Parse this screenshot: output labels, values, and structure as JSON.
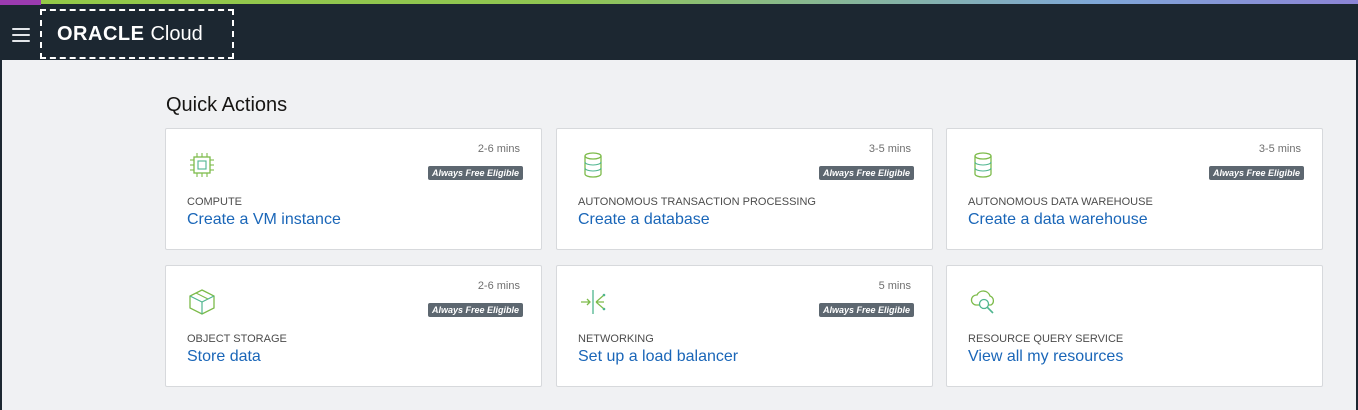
{
  "header": {
    "brand_oracle": "ORACLE",
    "brand_cloud": "Cloud",
    "menu_icon": "hamburger-menu-icon"
  },
  "colors": {
    "topbar": "#1c2731",
    "link": "#1a66b8",
    "badge": "#5d6770",
    "icon_green": "#7dbb4a",
    "icon_teal": "#4fb58f"
  },
  "quick_actions": {
    "title": "Quick Actions",
    "cards": [
      {
        "icon": "compute-chip-icon",
        "time": "2-6 mins",
        "badge": "Always Free Eligible",
        "category": "COMPUTE",
        "action": "Create a VM instance"
      },
      {
        "icon": "database-icon",
        "time": "3-5 mins",
        "badge": "Always Free Eligible",
        "category": "AUTONOMOUS TRANSACTION PROCESSING",
        "action": "Create a database"
      },
      {
        "icon": "database-icon",
        "time": "3-5 mins",
        "badge": "Always Free Eligible",
        "category": "AUTONOMOUS DATA WAREHOUSE",
        "action": "Create a data warehouse"
      },
      {
        "icon": "storage-box-icon",
        "time": "2-6 mins",
        "badge": "Always Free Eligible",
        "category": "OBJECT STORAGE",
        "action": "Store data"
      },
      {
        "icon": "load-balancer-icon",
        "time": "5 mins",
        "badge": "Always Free Eligible",
        "category": "NETWORKING",
        "action": "Set up a load balancer"
      },
      {
        "icon": "resource-search-icon",
        "time": "",
        "badge": "",
        "category": "RESOURCE QUERY SERVICE",
        "action": "View all my resources"
      }
    ]
  }
}
